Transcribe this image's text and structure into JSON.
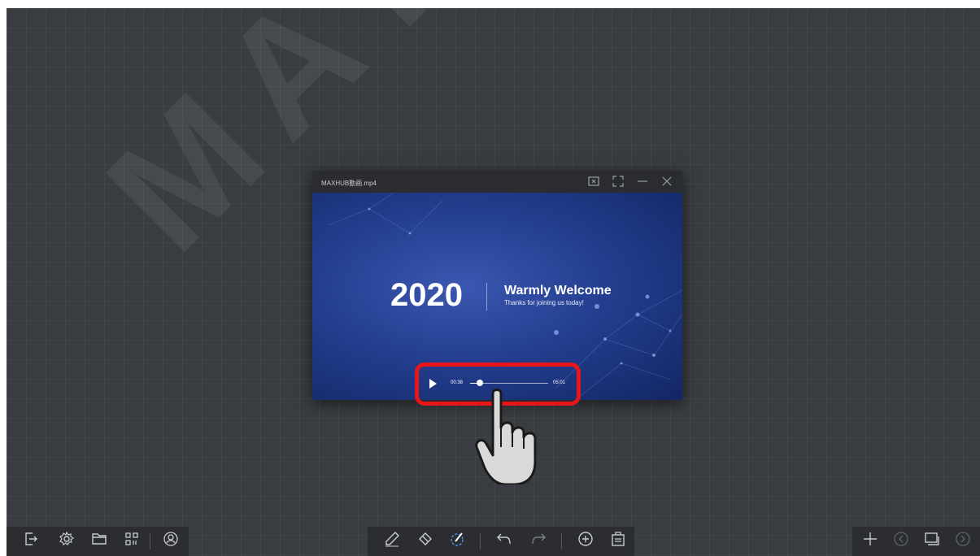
{
  "watermark": "MAYA S",
  "video_window": {
    "title": "MAXHUB動画.mp4",
    "icons": [
      "screen-share-icon",
      "expand-icon",
      "minimize-icon",
      "close-icon"
    ],
    "slide": {
      "year": "2020",
      "heading": "Warmly Welcome",
      "subheading": "Thanks for joining us today!"
    },
    "player": {
      "current_time": "00:38",
      "total_time": "05:01",
      "progress": 0.126
    }
  },
  "toolbar_left": [
    "exit-icon",
    "settings-icon",
    "folder-icon",
    "qr-code-icon",
    "user-icon"
  ],
  "toolbar_center": [
    "pen-icon",
    "eraser-icon",
    "select-icon",
    "undo-icon",
    "redo-icon",
    "add-icon",
    "clipboard-icon"
  ],
  "toolbar_right": [
    "plus-icon",
    "prev-page-icon",
    "page-list-icon",
    "next-page-icon"
  ],
  "colors": {
    "board": "#393c41",
    "highlight": "#e8151b",
    "toolbar": "#2b2d31"
  }
}
